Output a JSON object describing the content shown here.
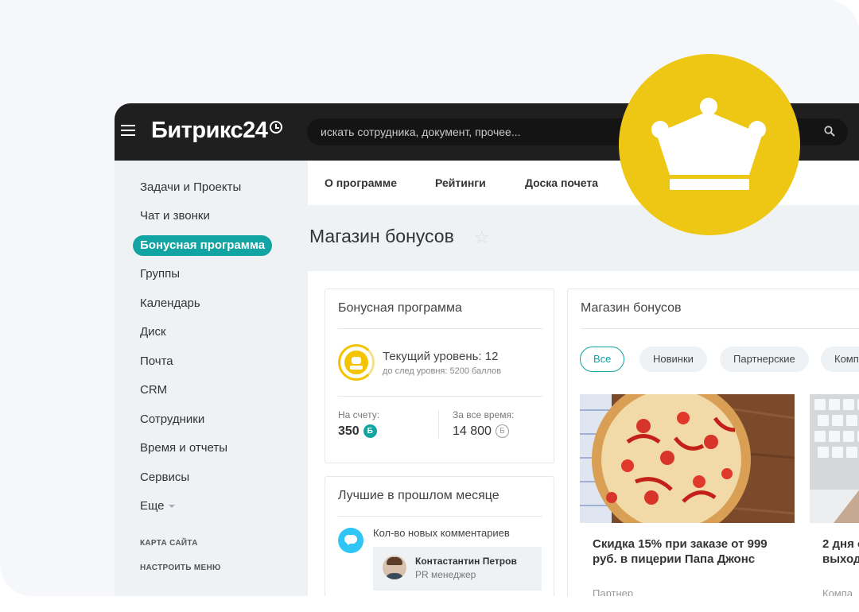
{
  "app": {
    "logo_text": "Битрикс24"
  },
  "search": {
    "placeholder": "искать сотрудника, документ, прочее..."
  },
  "sidebar": {
    "items": [
      {
        "label": "Задачи и Проекты"
      },
      {
        "label": "Чат и звонки"
      },
      {
        "label": "Бонусная программа",
        "active": true
      },
      {
        "label": "Группы"
      },
      {
        "label": "Календарь"
      },
      {
        "label": "Диск"
      },
      {
        "label": "Почта"
      },
      {
        "label": "CRM"
      },
      {
        "label": "Сотрудники"
      },
      {
        "label": "Время и отчеты"
      },
      {
        "label": "Сервисы"
      },
      {
        "label": "Еще"
      }
    ],
    "site_map": "КАРТА САЙТА",
    "configure_menu": "НАСТРОИТЬ МЕНЮ"
  },
  "tabs": [
    {
      "label": "О программе"
    },
    {
      "label": "Рейтинги"
    },
    {
      "label": "Доска почета"
    }
  ],
  "page": {
    "title": "Магазин бонусов"
  },
  "bonus_panel": {
    "title": "Бонусная программа",
    "level_text": "Текущий уровень: 12",
    "next_level_text": "до след уровня: 5200 баллов",
    "balance_label": "На счету:",
    "balance_value": "350",
    "balance_coin": "Б",
    "total_label": "За все время:",
    "total_value": "14 800",
    "total_coin": "Б"
  },
  "best_panel": {
    "title": "Лучшие в прошлом месяце",
    "metric": "Кол-во новых комментариев",
    "person_name": "Контастантин Петров",
    "person_role": "PR менеджер"
  },
  "shop_panel": {
    "title": "Магазин бонусов",
    "filters": [
      {
        "label": "Все",
        "active": true
      },
      {
        "label": "Новинки"
      },
      {
        "label": "Партнерские"
      },
      {
        "label": "Комп"
      }
    ],
    "products": [
      {
        "title": "Скидка 15% при заказе от 999 руб. в пицерии Папа Джонс",
        "partner": "Партнер"
      },
      {
        "title": "2 дня о выход",
        "partner": "Компа"
      }
    ]
  },
  "colors": {
    "accent": "#12a3a3",
    "crown_badge": "#eec614",
    "topbar": "#1f1f1f"
  }
}
